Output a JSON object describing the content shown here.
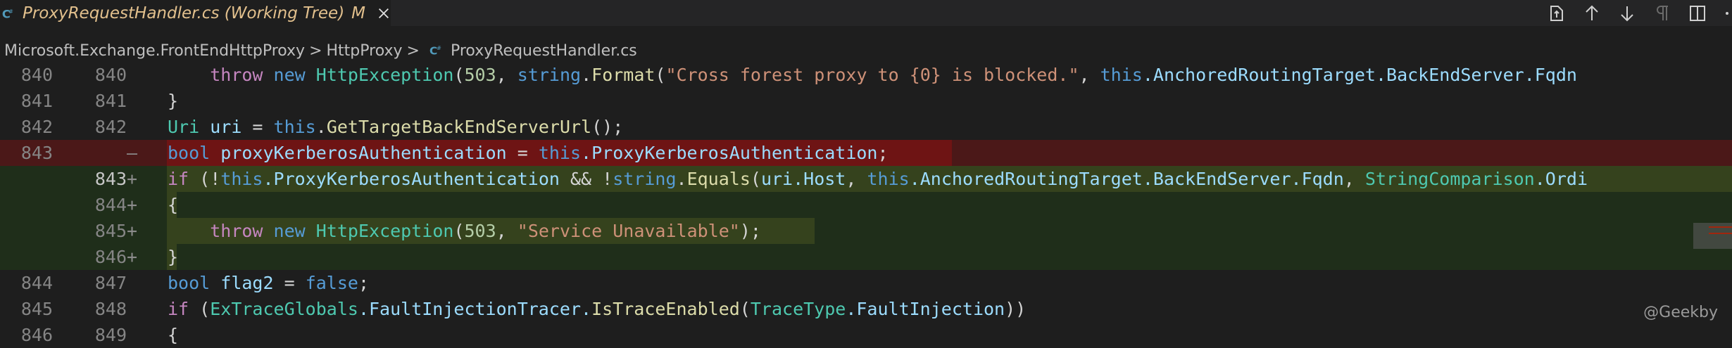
{
  "tab": {
    "icon": "csharp-file-icon",
    "title": "ProxyRequestHandler.cs (Working Tree)",
    "modified": "M"
  },
  "toolbar": {
    "icons": [
      "open-changes-icon",
      "previous-change-icon",
      "next-change-icon",
      "pilcrow-icon",
      "split-editor-icon",
      "more-actions-icon"
    ]
  },
  "breadcrumb": {
    "items": [
      "Microsoft.Exchange.FrontEndHttpProxy",
      "HttpProxy",
      "ProxyRequestHandler.cs"
    ],
    "separator": ">"
  },
  "lines": [
    {
      "old": "840",
      "new": "840",
      "sign": ""
    },
    {
      "old": "841",
      "new": "841",
      "sign": ""
    },
    {
      "old": "842",
      "new": "842",
      "sign": ""
    },
    {
      "old": "843",
      "new": "",
      "sign": "—"
    },
    {
      "old": "",
      "new": "843",
      "sign": "+"
    },
    {
      "old": "",
      "new": "844",
      "sign": "+"
    },
    {
      "old": "",
      "new": "845",
      "sign": "+"
    },
    {
      "old": "",
      "new": "846",
      "sign": "+"
    },
    {
      "old": "844",
      "new": "847",
      "sign": ""
    },
    {
      "old": "845",
      "new": "848",
      "sign": ""
    },
    {
      "old": "846",
      "new": "849",
      "sign": ""
    }
  ],
  "code": {
    "l840": {
      "throw": "throw",
      "new": "new",
      "type": "HttpException",
      "p1": "(",
      "num": "503",
      "p2": ", ",
      "str": "string",
      "dot": ".",
      "fmt": "Format",
      "p3": "(",
      "lit": "\"Cross forest proxy to {0} is blocked.\"",
      "p4": ", ",
      "this": "this",
      "rest": ".AnchoredRoutingTarget.BackEndServer.Fqdn"
    },
    "l841": {
      "brace": "}"
    },
    "l842": {
      "type": "Uri",
      "var": "uri",
      "eq": " = ",
      "this": "this",
      "dot": ".",
      "fn": "GetTargetBackEndServerUrl",
      "end": "();"
    },
    "l843del": {
      "type": "bool",
      "var": "proxyKerberosAuthentication",
      "eq": " = ",
      "this": "this",
      "rest": ".ProxyKerberosAuthentication",
      "end": ";"
    },
    "l843add": {
      "if": "if",
      "p1": " (!",
      "this": "this",
      "prop": ".ProxyKerberosAuthentication",
      "op": " && !",
      "str": "string",
      "dot": ".",
      "fn": "Equals",
      "p2": "(",
      "uri": "uri",
      "host": ".Host",
      "c": ", ",
      "this2": "this",
      "rest": ".AnchoredRoutingTarget.BackEndServer.Fqdn",
      "c2": ", ",
      "sc": "StringComparison",
      "tail": ".Ordi"
    },
    "l844add": {
      "brace": "{"
    },
    "l845add": {
      "throw": "throw",
      "new": "new",
      "type": "HttpException",
      "p1": "(",
      "num": "503",
      "p2": ", ",
      "lit": "\"Service Unavailable\"",
      "end": ");"
    },
    "l846add": {
      "brace": "}"
    },
    "l847": {
      "type": "bool",
      "var": "flag2",
      "eq": " = ",
      "val": "false",
      "end": ";"
    },
    "l848": {
      "if": "if",
      "p1": " (",
      "cls": "ExTraceGlobals",
      "prop": ".FaultInjectionTracer.",
      "fn": "IsTraceEnabled",
      "p2": "(",
      "tt": "TraceType",
      "rest": ".FaultInjection",
      "end": "))"
    },
    "l849": {
      "brace": "{"
    }
  },
  "watermark": "@Geekby",
  "colors": {
    "deleted_line": "#4b1818",
    "deleted_highlight": "#6e1414",
    "added_line": "#1f2e1a",
    "added_highlight": "#35421d",
    "tab_title": "#e2c08d"
  }
}
